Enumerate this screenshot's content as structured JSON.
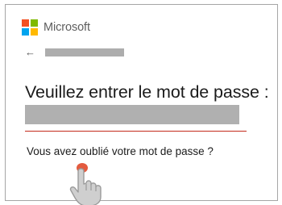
{
  "brand": {
    "name": "Microsoft",
    "logo_colors": [
      "#f25022",
      "#7fba00",
      "#00a4ef",
      "#ffb900"
    ]
  },
  "back": {
    "icon": "arrow-left-icon",
    "glyph": "←"
  },
  "identity": {
    "redacted": true
  },
  "heading": "Veuillez entrer le mot de passe :",
  "password_field": {
    "value": "",
    "redacted": true
  },
  "error_color": "#c42b1c",
  "forgot_link": "Vous avez oublié votre mot de passe ?",
  "pointer": {
    "icon": "hand-pointer-icon",
    "highlight_color": "#e35b3f"
  }
}
